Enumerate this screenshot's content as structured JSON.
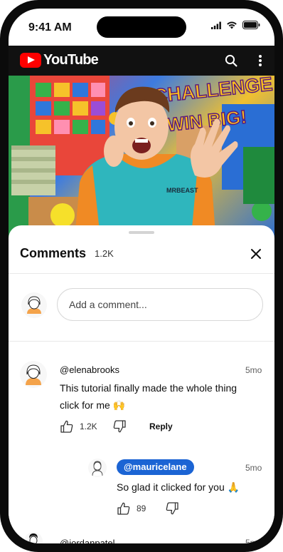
{
  "status_bar": {
    "time": "9:41 AM"
  },
  "youtube": {
    "logo_text": "YouTube"
  },
  "video": {
    "banner_line1": "CHALLENGE",
    "banner_line2": "WIN BIG!",
    "shirt_text": "MRBEAST"
  },
  "comments": {
    "title": "Comments",
    "count": "1.2K",
    "add_placeholder": "Add a comment...",
    "items": [
      {
        "user": "@elenabrooks",
        "time": "5mo",
        "text_line1": "This tutorial finally made the whole thing",
        "text_line2": "click for me 🙌",
        "likes": "1.2K",
        "reply_label": "Reply"
      },
      {
        "user": "@mauricelane",
        "time": "5mo",
        "text": "So glad it clicked for you 🙏",
        "likes": "89"
      },
      {
        "user": "@jordanpatel",
        "time": "5m"
      }
    ]
  },
  "colors": {
    "youtube_red": "#ff0000",
    "mention_blue": "#1b64d4",
    "youtube_bar": "#111111"
  },
  "icons": [
    "signal-icon",
    "wifi-icon",
    "battery-icon",
    "search-icon",
    "more-vert-icon",
    "close-icon",
    "thumbs-up-icon",
    "thumbs-down-icon"
  ]
}
